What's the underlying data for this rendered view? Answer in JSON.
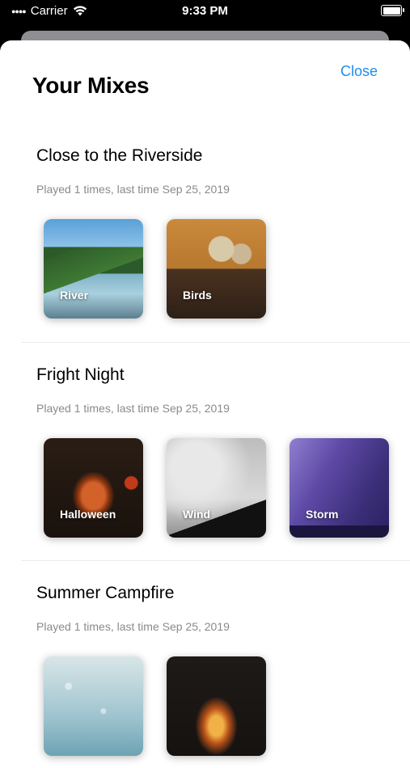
{
  "status_bar": {
    "carrier": "Carrier",
    "time": "9:33 PM"
  },
  "header": {
    "close_label": "Close",
    "title": "Your Mixes"
  },
  "mixes": [
    {
      "title": "Close to the Riverside",
      "meta": "Played 1 times, last time Sep 25, 2019",
      "sounds": [
        {
          "label": "River",
          "icon": "river-image"
        },
        {
          "label": "Birds",
          "icon": "birds-image"
        }
      ]
    },
    {
      "title": "Fright Night",
      "meta": "Played 1 times, last time Sep 25, 2019",
      "sounds": [
        {
          "label": "Halloween",
          "icon": "halloween-image"
        },
        {
          "label": "Wind",
          "icon": "wind-image"
        },
        {
          "label": "Storm",
          "icon": "storm-image"
        }
      ]
    },
    {
      "title": "Summer Campfire",
      "meta": "Played 1 times, last time Sep 25, 2019",
      "sounds": [
        {
          "label": "",
          "icon": "rain-image"
        },
        {
          "label": "",
          "icon": "campfire-image"
        }
      ]
    }
  ],
  "colors": {
    "accent": "#1f8cf0",
    "meta_text": "#8a8a8e",
    "divider": "#ececee"
  }
}
